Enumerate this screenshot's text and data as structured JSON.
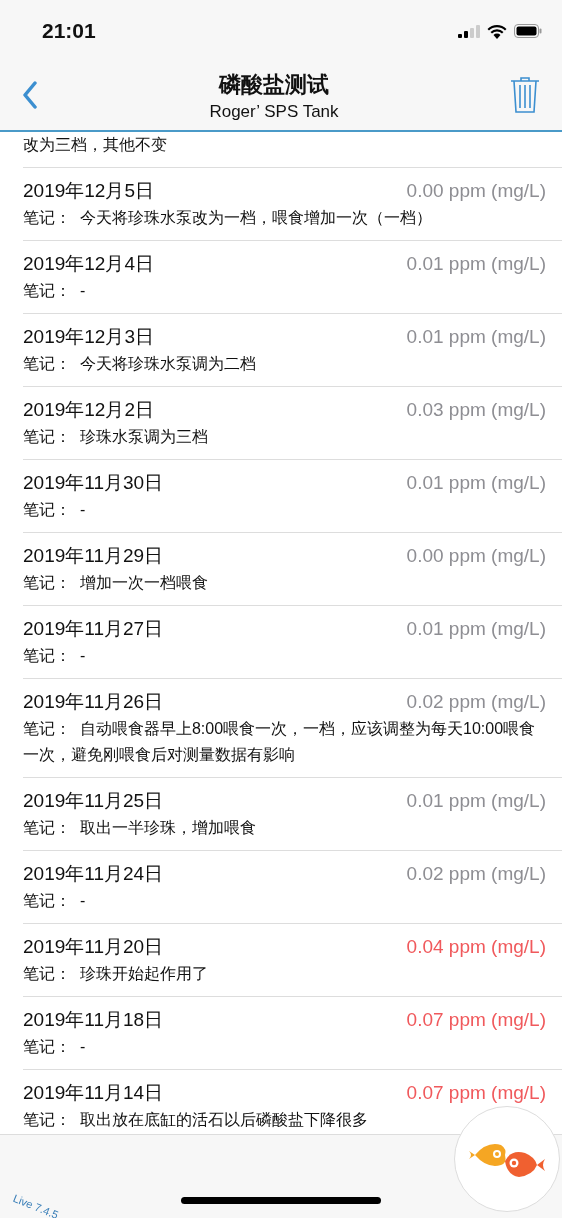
{
  "status_bar": {
    "time": "21:01"
  },
  "nav": {
    "title": "磷酸盐测试",
    "subtitle": "Roger’ SPS Tank"
  },
  "partial_note": "改为三档，其他不变",
  "records": [
    {
      "date": "2019年12月5日",
      "value": "0.00 ppm (mg/L)",
      "alert": false,
      "note_label": "笔记：",
      "note": "今天将珍珠水泵改为一档，喂食增加一次（一档）"
    },
    {
      "date": "2019年12月4日",
      "value": "0.01 ppm (mg/L)",
      "alert": false,
      "note_label": "笔记：",
      "note": "-"
    },
    {
      "date": "2019年12月3日",
      "value": "0.01 ppm (mg/L)",
      "alert": false,
      "note_label": "笔记：",
      "note": "今天将珍珠水泵调为二档"
    },
    {
      "date": "2019年12月2日",
      "value": "0.03 ppm (mg/L)",
      "alert": false,
      "note_label": "笔记：",
      "note": "珍珠水泵调为三档"
    },
    {
      "date": "2019年11月30日",
      "value": "0.01 ppm (mg/L)",
      "alert": false,
      "note_label": "笔记：",
      "note": "-"
    },
    {
      "date": "2019年11月29日",
      "value": "0.00 ppm (mg/L)",
      "alert": false,
      "note_label": "笔记：",
      "note": "增加一次一档喂食"
    },
    {
      "date": "2019年11月27日",
      "value": "0.01 ppm (mg/L)",
      "alert": false,
      "note_label": "笔记：",
      "note": "-"
    },
    {
      "date": "2019年11月26日",
      "value": "0.02 ppm (mg/L)",
      "alert": false,
      "note_label": "笔记：",
      "note": "自动喂食器早上8:00喂食一次，一档，应该调整为每天10:00喂食一次，避免刚喂食后对测量数据有影响"
    },
    {
      "date": "2019年11月25日",
      "value": "0.01 ppm (mg/L)",
      "alert": false,
      "note_label": "笔记：",
      "note": "取出一半珍珠，增加喂食"
    },
    {
      "date": "2019年11月24日",
      "value": "0.02 ppm (mg/L)",
      "alert": false,
      "note_label": "笔记：",
      "note": "-"
    },
    {
      "date": "2019年11月20日",
      "value": "0.04 ppm (mg/L)",
      "alert": true,
      "note_label": "笔记：",
      "note": "珍珠开始起作用了"
    },
    {
      "date": "2019年11月18日",
      "value": "0.07 ppm (mg/L)",
      "alert": true,
      "note_label": "笔记：",
      "note": "-"
    },
    {
      "date": "2019年11月14日",
      "value": "0.07 ppm (mg/L)",
      "alert": true,
      "note_label": "笔记：",
      "note": "取出放在底缸的活石以后磷酸盐下降很多"
    }
  ],
  "footer": {
    "version": "Live 7.4.5"
  }
}
